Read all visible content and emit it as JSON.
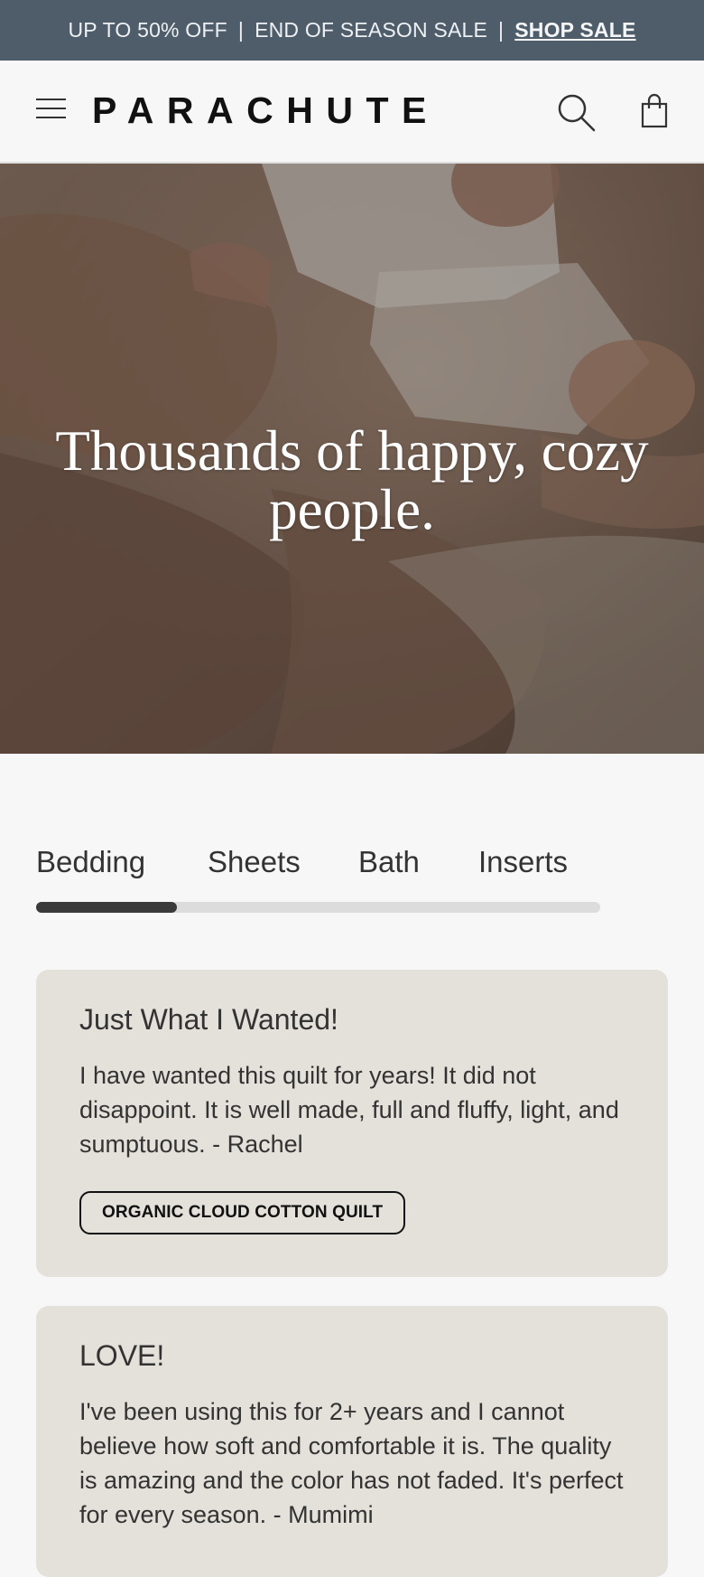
{
  "promo": {
    "text_1": "UP TO 50% OFF",
    "separator": "|",
    "text_2": "END OF SEASON SALE",
    "link_label": "SHOP SALE",
    "background": "#4f5d6a"
  },
  "header": {
    "brand": "PARACHUTE",
    "menu_icon": "hamburger-icon",
    "search_icon": "search-icon",
    "bag_icon": "shopping-bag-icon"
  },
  "hero": {
    "title": "Thousands of happy, cozy people."
  },
  "tabs": {
    "items": [
      {
        "label": "Bedding"
      },
      {
        "label": "Sheets"
      },
      {
        "label": "Bath"
      },
      {
        "label": "Inserts"
      }
    ],
    "active_index": 0,
    "progress_fraction": 0.25
  },
  "reviews": [
    {
      "title": "Just What I Wanted!",
      "text": "I have wanted this quilt for years! It did not disappoint. It is well made, full and fluffy, light, and sumptuous. - Rachel",
      "product": "ORGANIC CLOUD COTTON QUILT"
    },
    {
      "title": "LOVE!",
      "text": "I've been using this for 2+ years and I cannot believe how soft and comfortable it is. The quality is amazing and the color has not faded. It's perfect for every season. - Mumimi"
    }
  ]
}
